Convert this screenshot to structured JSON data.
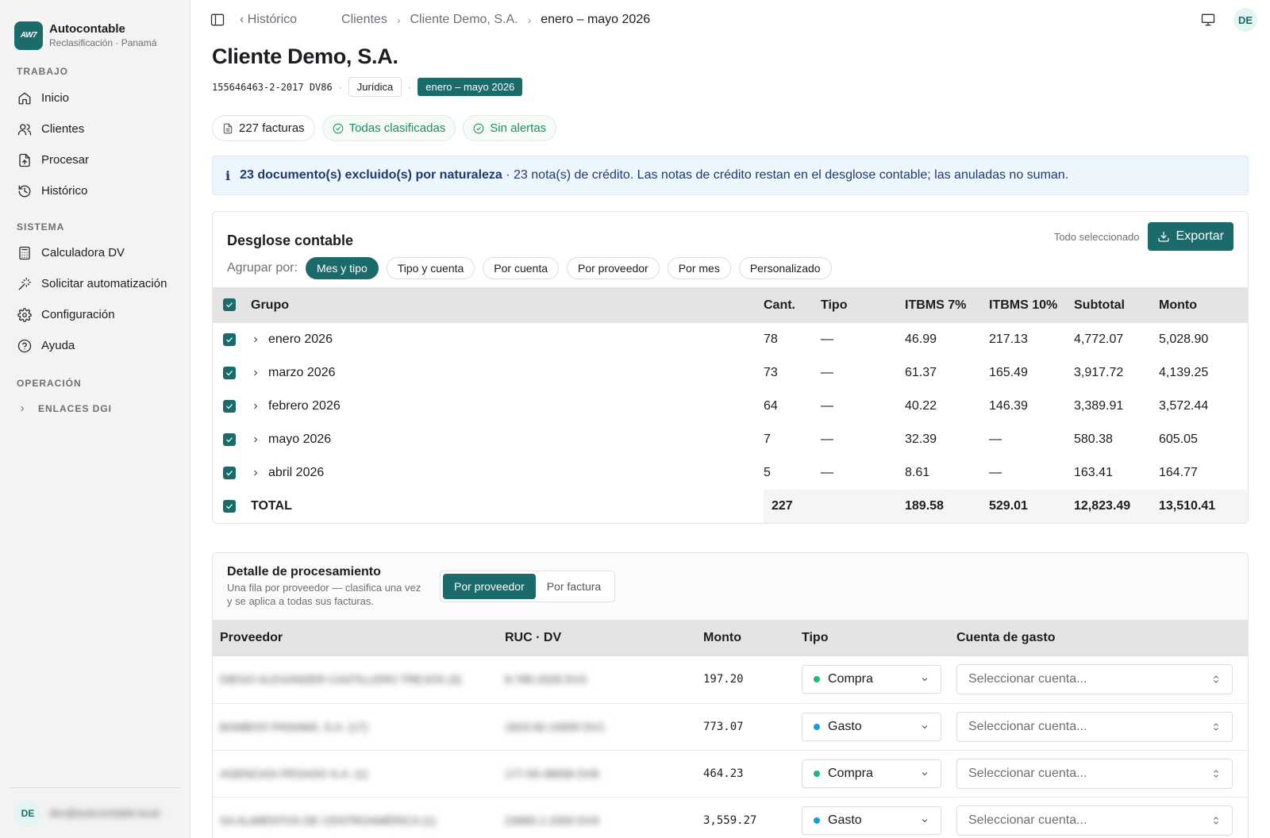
{
  "brand": {
    "logo": "AW7",
    "name": "Autocontable",
    "subtitle": "Reclasificación · Panamá"
  },
  "nav": {
    "sections": [
      {
        "title": "TRABAJO",
        "items": [
          {
            "label": "Inicio",
            "icon": "home-icon"
          },
          {
            "label": "Clientes",
            "icon": "users-icon"
          },
          {
            "label": "Procesar",
            "icon": "file-upload-icon"
          },
          {
            "label": "Histórico",
            "icon": "history-icon"
          }
        ]
      },
      {
        "title": "SISTEMA",
        "items": [
          {
            "label": "Calculadora DV",
            "icon": "calculator-icon"
          },
          {
            "label": "Solicitar automatización",
            "icon": "wand-icon"
          },
          {
            "label": "Configuración",
            "icon": "gear-icon"
          },
          {
            "label": "Ayuda",
            "icon": "help-icon"
          }
        ]
      },
      {
        "title": "OPERACIÓN",
        "items": []
      }
    ],
    "collapsible": "ENLACES DGI"
  },
  "user": {
    "initials": "DE",
    "email": "dev@autocontable.local"
  },
  "breadcrumb": {
    "back": "Histórico",
    "items": [
      "Clientes",
      "Cliente Demo, S.A.",
      "enero – mayo 2026"
    ]
  },
  "client": {
    "name": "Cliente Demo, S.A.",
    "ruc": "155646463-2-2017 DV86",
    "type": "Jurídica",
    "period": "enero – mayo 2026"
  },
  "chips": [
    "227 facturas",
    "Todas clasificadas",
    "Sin alertas"
  ],
  "info": {
    "bold": "23 documento(s) excluido(s) por naturaleza",
    "text": " · 23 nota(s) de crédito. Las notas de crédito restan en el desglose contable; las anuladas no suman."
  },
  "desglose": {
    "title": "Desglose contable",
    "selection_status": "Todo seleccionado",
    "export_label": "Exportar",
    "group_by_label": "Agrupar por:",
    "group_options": [
      "Mes y tipo",
      "Tipo y cuenta",
      "Por cuenta",
      "Por proveedor",
      "Por mes",
      "Personalizado"
    ],
    "active_option": "Mes y tipo",
    "columns": [
      "Grupo",
      "Cant.",
      "Tipo",
      "ITBMS 7%",
      "ITBMS 10%",
      "Subtotal",
      "Monto"
    ],
    "rows": [
      {
        "grupo": "enero 2026",
        "cant": "78",
        "tipo": "—",
        "itbms7": "46.99",
        "itbms10": "217.13",
        "subtotal": "4,772.07",
        "monto": "5,028.90"
      },
      {
        "grupo": "marzo 2026",
        "cant": "73",
        "tipo": "—",
        "itbms7": "61.37",
        "itbms10": "165.49",
        "subtotal": "3,917.72",
        "monto": "4,139.25"
      },
      {
        "grupo": "febrero 2026",
        "cant": "64",
        "tipo": "—",
        "itbms7": "40.22",
        "itbms10": "146.39",
        "subtotal": "3,389.91",
        "monto": "3,572.44"
      },
      {
        "grupo": "mayo 2026",
        "cant": "7",
        "tipo": "—",
        "itbms7": "32.39",
        "itbms10": "—",
        "subtotal": "580.38",
        "monto": "605.05"
      },
      {
        "grupo": "abril 2026",
        "cant": "5",
        "tipo": "—",
        "itbms7": "8.61",
        "itbms10": "—",
        "subtotal": "163.41",
        "monto": "164.77"
      }
    ],
    "total": {
      "label": "TOTAL",
      "cant": "227",
      "itbms7": "189.58",
      "itbms10": "529.01",
      "subtotal": "12,823.49",
      "monto": "13,510.41"
    }
  },
  "detalle": {
    "title": "Detalle de procesamiento",
    "subtitle": "Una fila por proveedor — clasifica una vez y se aplica a todas sus facturas.",
    "tabs": [
      "Por proveedor",
      "Por factura"
    ],
    "active_tab": "Por proveedor",
    "columns": [
      "Proveedor",
      "RUC · DV",
      "Monto",
      "Tipo",
      "Cuenta de gasto"
    ],
    "account_placeholder": "Seleccionar cuenta...",
    "rows": [
      {
        "proveedor": "DIEGO ALEXANDER CASTILLERO TREJOS",
        "count": "(3)",
        "ruc": "8-785-2026",
        "dv": "DV3",
        "monto": "197.20",
        "tipo": "Compra",
        "tipo_color": "#22b573"
      },
      {
        "proveedor": "BAMBOO PANAMÁ, S.A.",
        "count": "(17)",
        "ruc": "1823-92-10000",
        "dv": "DV1",
        "monto": "773.07",
        "tipo": "Gasto",
        "tipo_color": "#1a9be0"
      },
      {
        "proveedor": "AGENCIAS PEGASO S.A.",
        "count": "(1)",
        "ruc": "177-93-38058",
        "dv": "DV8",
        "monto": "464.23",
        "tipo": "Compra",
        "tipo_color": "#22b573"
      },
      {
        "proveedor": "SA ALIMENTOS DE CENTROAMÉRICA",
        "count": "(1)",
        "ruc": "23965-1-2000",
        "dv": "DV9",
        "monto": "3,559.27",
        "tipo": "Gasto",
        "tipo_color": "#1a9be0"
      }
    ]
  }
}
